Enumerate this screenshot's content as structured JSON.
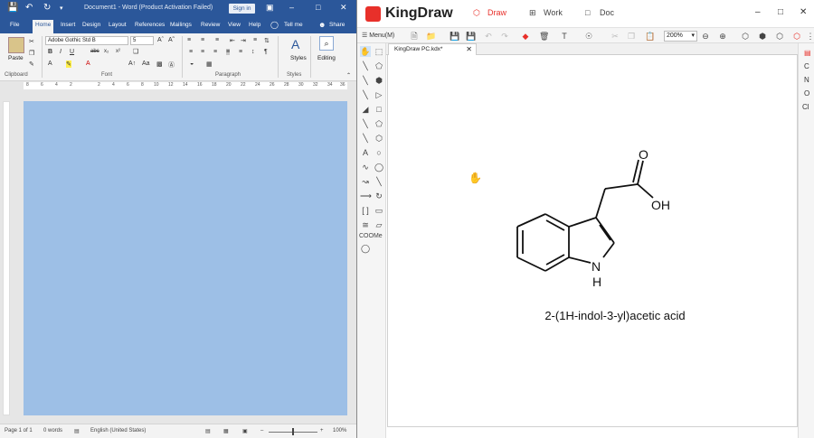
{
  "word": {
    "title": "Document1 - Word (Product Activation Failed)",
    "signin": "Sign in",
    "tabs": [
      "File",
      "Home",
      "Insert",
      "Design",
      "Layout",
      "References",
      "Mailings",
      "Review",
      "View",
      "Help",
      "Tell me",
      "Share"
    ],
    "active_tab": "Home",
    "font_name": "Adobe Gothic Std B",
    "font_size": "5",
    "groups": {
      "paste": "Paste",
      "clipboard": "Clipboard",
      "font": "Font",
      "paragraph": "Paragraph",
      "styles": "Styles",
      "styles_btn": "Styles",
      "editing": "Editing"
    },
    "ruler_numbers": [
      "8",
      "6",
      "4",
      "2",
      "2",
      "4",
      "6",
      "8",
      "10",
      "12",
      "14",
      "16",
      "18",
      "20",
      "22",
      "24",
      "26",
      "28",
      "30",
      "32",
      "34",
      "36"
    ],
    "status": {
      "page": "Page 1 of 1",
      "words": "0 words",
      "language": "English (United States)",
      "zoom": "100%"
    }
  },
  "kingdraw": {
    "app_title": "KingDraw",
    "modes": [
      "Draw",
      "Work",
      "Doc"
    ],
    "active_mode": "Draw",
    "menu_label": "Menu(M)",
    "zoom": "200%",
    "doc_tab": "KingDraw PC.kdx*",
    "left_text_tools": [
      "A",
      "COOMe"
    ],
    "elements": [
      "C",
      "N",
      "O",
      "Cl"
    ],
    "molecule": {
      "atoms": {
        "oxygen_double": "O",
        "hydroxyl": "OH",
        "nitrogen": "N",
        "nitrogen_h": "H"
      },
      "name": "2-(1H-indol-3-yl)acetic acid"
    }
  }
}
